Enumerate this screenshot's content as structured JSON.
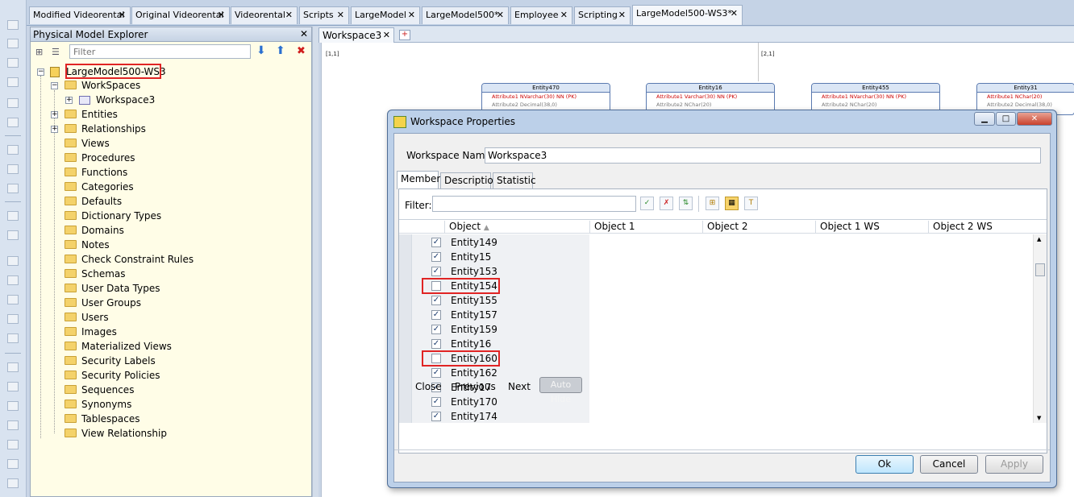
{
  "doc_tabs": [
    {
      "label": "Modified Videorental"
    },
    {
      "label": "Original Videorental"
    },
    {
      "label": "Videorental"
    },
    {
      "label": "Scripts"
    },
    {
      "label": "LargeModel"
    },
    {
      "label": "LargeModel500*"
    },
    {
      "label": "Employee"
    },
    {
      "label": "Scripting"
    },
    {
      "label": "LargeModel500-WS3*"
    }
  ],
  "explorer": {
    "title": "Physical Model Explorer",
    "filter_placeholder": "Filter",
    "root": "LargeModel500-WS3",
    "workspaces_folder": "WorkSpaces",
    "workspace_item": "Workspace3",
    "items": [
      "Entities",
      "Relationships",
      "Views",
      "Procedures",
      "Functions",
      "Categories",
      "Defaults",
      "Dictionary Types",
      "Domains",
      "Notes",
      "Check Constraint Rules",
      "Schemas",
      "User Data Types",
      "User Groups",
      "Users",
      "Images",
      "Materialized Views",
      "Security Labels",
      "Security Policies",
      "Sequences",
      "Synonyms",
      "Tablespaces",
      "View Relationship"
    ]
  },
  "workspace": {
    "tab_label": "Workspace3",
    "page_labels": [
      "[1,1]",
      "[2,1]"
    ],
    "entities": [
      {
        "name": "Entity470",
        "a1": "Attribute1   NVarchar(30)      NN  (PK)",
        "a2": "Attribute2   Decimal(38,0)"
      },
      {
        "name": "Entity16",
        "a1": "Attribute1   Varchar(30)       NN  (PK)",
        "a2": "Attribute2   NChar(20)"
      },
      {
        "name": "Entity455",
        "a1": "Attribute1   NVarchar(30)      NN  (PK)",
        "a2": "Attribute2   NChar(20)"
      },
      {
        "name": "Entity31",
        "a1": "Attribute1   NChar(20)",
        "a2": "Attribute2   Decimal(38,0)"
      }
    ]
  },
  "dialog": {
    "title": "Workspace Properties",
    "workspace_name_label": "Workspace Name:",
    "workspace_name_value": "Workspace3",
    "tabs": [
      "Members",
      "Description",
      "Statistic"
    ],
    "filter_label": "Filter:",
    "columns": [
      "Object",
      "Object 1",
      "Object 2",
      "Object 1 WS",
      "Object 2 WS"
    ],
    "rows": [
      {
        "name": "Entity149",
        "checked": true
      },
      {
        "name": "Entity15",
        "checked": true
      },
      {
        "name": "Entity153",
        "checked": true
      },
      {
        "name": "Entity154",
        "checked": false
      },
      {
        "name": "Entity155",
        "checked": true
      },
      {
        "name": "Entity157",
        "checked": true
      },
      {
        "name": "Entity159",
        "checked": true
      },
      {
        "name": "Entity16",
        "checked": true
      },
      {
        "name": "Entity160",
        "checked": false
      },
      {
        "name": "Entity162",
        "checked": true
      },
      {
        "name": "Entity17",
        "checked": true
      },
      {
        "name": "Entity170",
        "checked": true
      },
      {
        "name": "Entity174",
        "checked": true
      }
    ],
    "nav": {
      "close": "Close",
      "previous": "Previous",
      "next": "Next",
      "auto_hide": "Auto Hide"
    },
    "buttons": {
      "ok": "Ok",
      "cancel": "Cancel",
      "apply": "Apply"
    }
  }
}
